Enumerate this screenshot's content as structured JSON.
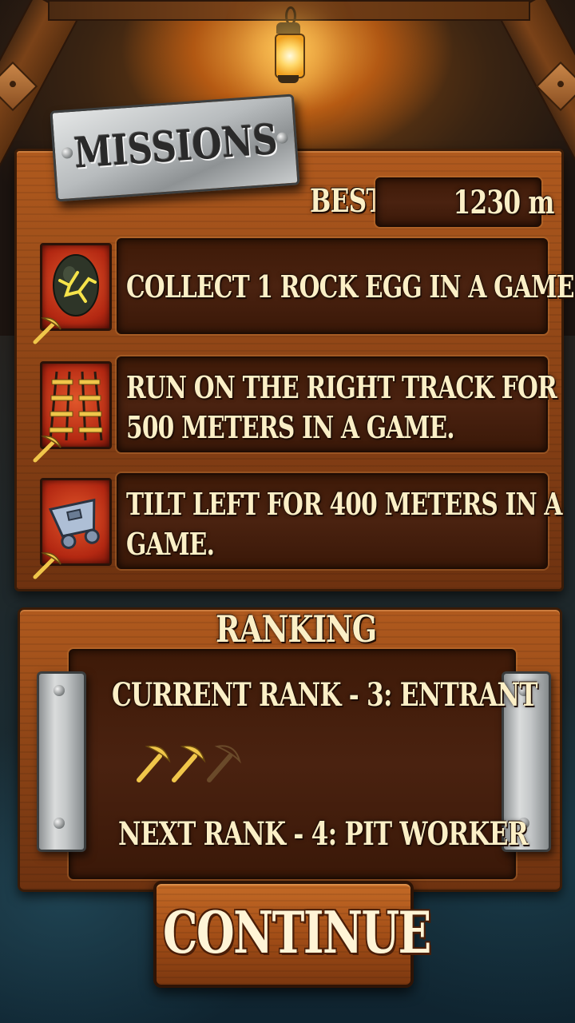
{
  "header": {
    "title": "MISSIONS"
  },
  "best": {
    "label": "BEST",
    "value": "1230 m"
  },
  "missions": [
    {
      "lines": [
        "COLLECT 1 ROCK EGG IN A GAME."
      ],
      "icon": "rock-egg-icon"
    },
    {
      "lines": [
        "RUN ON THE RIGHT TRACK FOR",
        "500 METERS IN A GAME."
      ],
      "icon": "rail-tracks-icon"
    },
    {
      "lines": [
        "TILT LEFT FOR 400 METERS IN A",
        "GAME."
      ],
      "icon": "mine-cart-icon"
    }
  ],
  "ranking": {
    "title": "RANKING",
    "current": "CURRENT RANK - 3: ENTRANT",
    "next": "NEXT RANK - 4: PIT WORKER",
    "pickaxes_earned": 2,
    "pickaxes_total": 3
  },
  "continue_label": "CONTINUE",
  "colors": {
    "wood": "#8d4416",
    "text": "#fbefc6",
    "icon_red": "#b32812",
    "gold": "#f0c64a"
  }
}
